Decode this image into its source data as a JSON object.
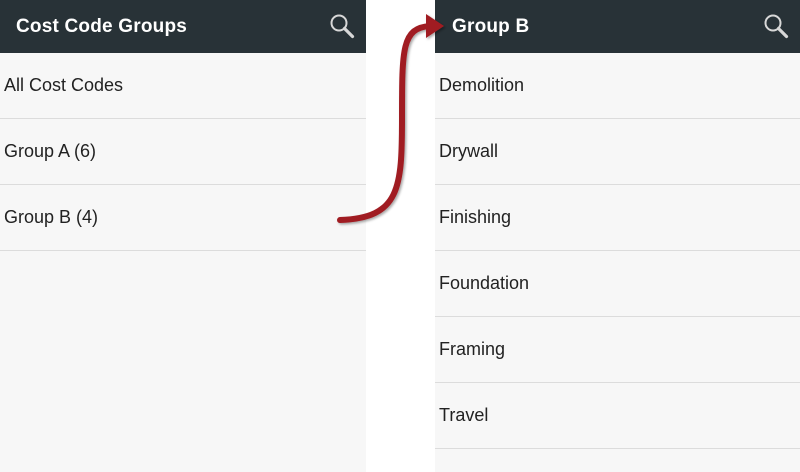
{
  "left_screen": {
    "title": "Cost Code Groups",
    "search_icon": "search-icon",
    "items": [
      {
        "label": "All Cost Codes"
      },
      {
        "label": "Group A (6)"
      },
      {
        "label": "Group B (4)"
      }
    ]
  },
  "right_screen": {
    "title": "Group B",
    "search_icon": "search-icon",
    "items": [
      {
        "label": "Demolition"
      },
      {
        "label": "Drywall"
      },
      {
        "label": "Finishing"
      },
      {
        "label": "Foundation"
      },
      {
        "label": "Framing"
      },
      {
        "label": "Travel"
      }
    ]
  },
  "colors": {
    "appbar": "#283237",
    "list_background": "#f7f7f7",
    "divider": "#dcdcdc",
    "arrow": "#a01e24"
  }
}
